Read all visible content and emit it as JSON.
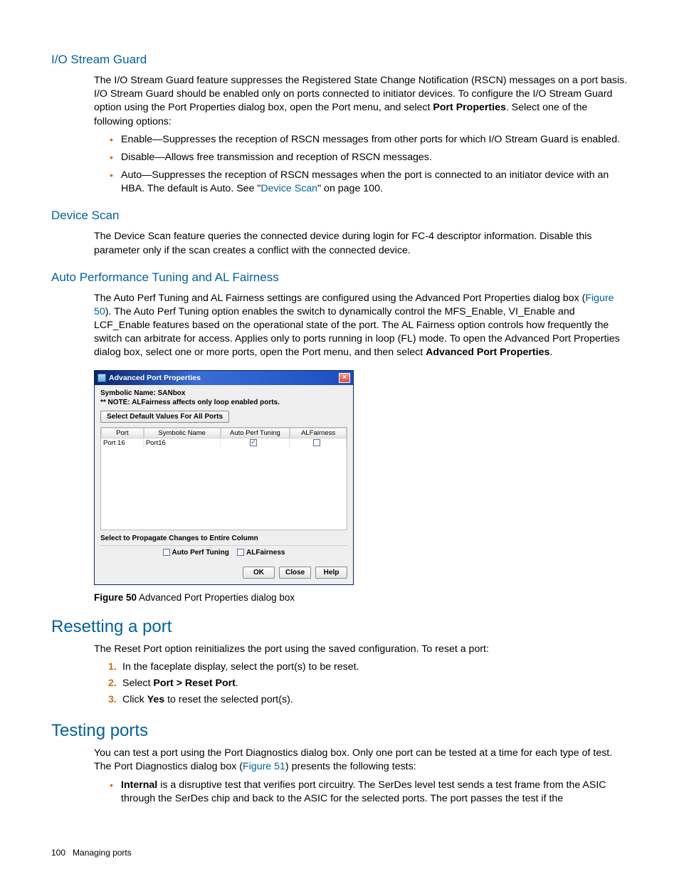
{
  "sections": {
    "io_stream_guard": {
      "heading": "I/O Stream Guard",
      "para_before": "The I/O Stream Guard feature suppresses the Registered State Change Notification (RSCN) messages on a port basis. I/O Stream Guard should be enabled only on ports connected to initiator devices. To configure the I/O Stream Guard option using the Port Properties dialog box, open the Port menu, and select ",
      "para_bold": "Port Properties",
      "para_after": ". Select one of the following options:",
      "bullets": [
        "Enable—Suppresses the reception of RSCN messages from other ports for which I/O Stream Guard is enabled.",
        "Disable—Allows free transmission and reception of RSCN messages."
      ],
      "bullet3_before": "Auto—Suppresses the reception of RSCN messages when the port is connected to an initiator device with an HBA. The default is Auto. See \"",
      "bullet3_link": "Device Scan",
      "bullet3_after": "\" on page 100."
    },
    "device_scan": {
      "heading": "Device Scan",
      "para": "The Device Scan feature queries the connected device during login for FC-4 descriptor information. Disable this parameter only if the scan creates a conflict with the connected device."
    },
    "auto_perf": {
      "heading": "Auto Performance Tuning and AL Fairness",
      "para_before": "The Auto Perf Tuning and AL Fairness settings are configured using the Advanced Port Properties dialog box (",
      "para_link": "Figure 50",
      "para_mid": "). The Auto Perf Tuning option enables the switch to dynamically control the MFS_Enable, VI_Enable and LCF_Enable features based on the operational state of the port. The AL Fairness option controls how frequently the switch can arbitrate for access. Applies only to ports running in loop (FL) mode. To open the Advanced Port Properties dialog box, select one or more ports, open the Port menu, and then select ",
      "para_bold": "Advanced Port Properties",
      "para_after": "."
    },
    "resetting": {
      "heading": "Resetting a port",
      "intro": "The Reset Port option reinitializes the port using the saved configuration. To reset a port:",
      "steps": {
        "s1": "In the faceplate display, select the port(s) to be reset.",
        "s2_a": "Select ",
        "s2_b": "Port > Reset Port",
        "s2_c": ".",
        "s3_a": "Click ",
        "s3_b": "Yes",
        "s3_c": " to reset the selected port(s)."
      }
    },
    "testing": {
      "heading": "Testing ports",
      "para_before": "You can test a port using the Port Diagnostics dialog box. Only one port can be tested at a time for each type of test. The Port Diagnostics dialog box (",
      "para_link": "Figure 51",
      "para_after": ") presents the following tests:",
      "bullet_bold": "Internal",
      "bullet_rest": " is a disruptive test that verifies port circuitry. The SerDes level test sends a test frame from the ASIC through the SerDes chip and back to the ASIC for the selected ports. The port passes the test if the"
    }
  },
  "dialog": {
    "title": "Advanced Port Properties",
    "symname_label": "Symbolic Name: SANbox",
    "note": "** NOTE: ALFairness affects only loop enabled ports.",
    "defaults_btn": "Select Default Values For All Ports",
    "cols": {
      "port": "Port",
      "sym": "Symbolic Name",
      "apt": "Auto Perf Tuning",
      "alf": "ALFairness"
    },
    "row": {
      "port": "Port 16",
      "sym": "Port16",
      "apt_checked": true,
      "alf_checked": false
    },
    "propagate_label": "Select to Propagate Changes to Entire Column",
    "propagate_apt": "Auto Perf Tuning",
    "propagate_alf": "ALFairness",
    "buttons": {
      "ok": "OK",
      "close": "Close",
      "help": "Help"
    }
  },
  "figure": {
    "label": "Figure 50",
    "caption": " Advanced Port Properties dialog box"
  },
  "footer": {
    "page": "100",
    "section": "Managing ports"
  }
}
